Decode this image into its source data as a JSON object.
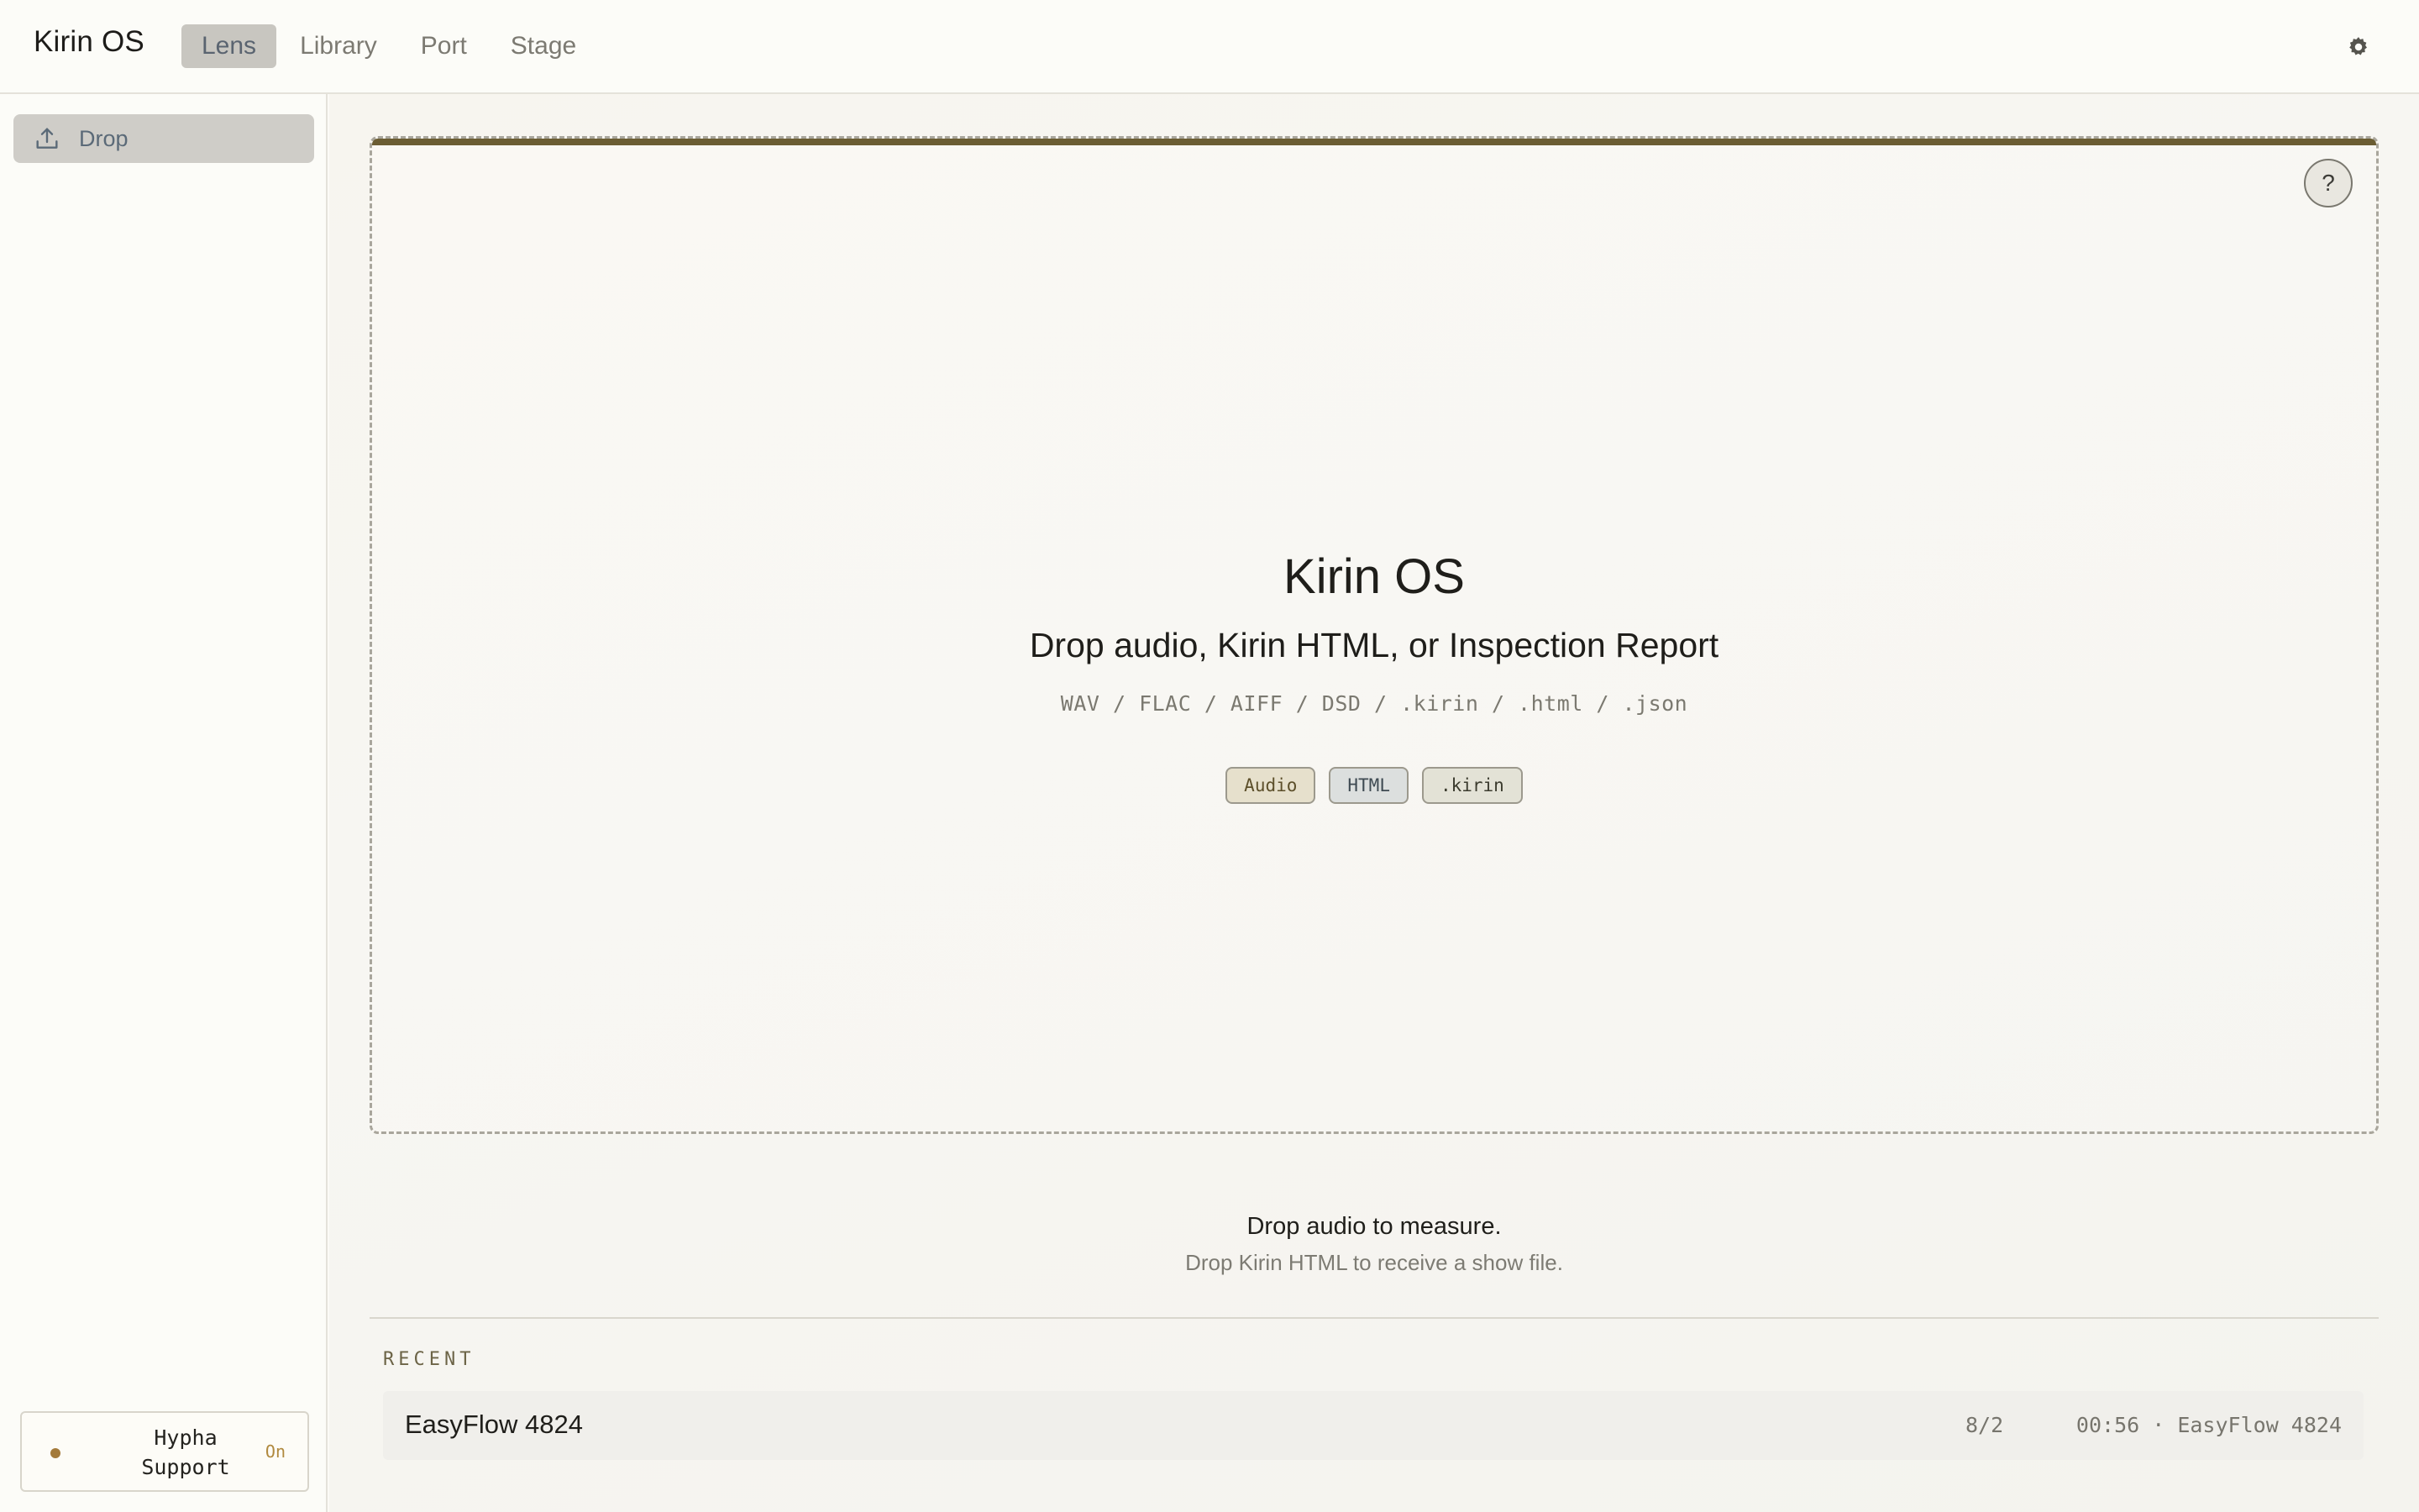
{
  "app": {
    "title": "Kirin OS"
  },
  "tabs": [
    {
      "label": "Lens",
      "active": true
    },
    {
      "label": "Library",
      "active": false
    },
    {
      "label": "Port",
      "active": false
    },
    {
      "label": "Stage",
      "active": false
    }
  ],
  "header": {
    "settings_icon": "gear-icon"
  },
  "sidebar": {
    "items": [
      {
        "label": "Drop",
        "icon": "upload-icon",
        "active": true
      }
    ],
    "hypha": {
      "name": "Hypha Support",
      "state": "On",
      "dot_color": "#a37a3a"
    }
  },
  "dropzone": {
    "title": "Kirin OS",
    "subtitle": "Drop audio, Kirin HTML, or Inspection Report",
    "formats": "WAV / FLAC / AIFF / DSD / .kirin / .html / .json",
    "chips": [
      "Audio",
      "HTML",
      ".kirin"
    ],
    "help_label": "?",
    "accent_color": "#6b5d33"
  },
  "message": {
    "title": "Drop audio to measure.",
    "subtitle": "Drop Kirin HTML to receive a show file."
  },
  "recent": {
    "label": "RECENT",
    "items": [
      {
        "title": "EasyFlow 4824",
        "ratio": "8/2",
        "meta": "00:56 · EasyFlow 4824"
      }
    ]
  }
}
